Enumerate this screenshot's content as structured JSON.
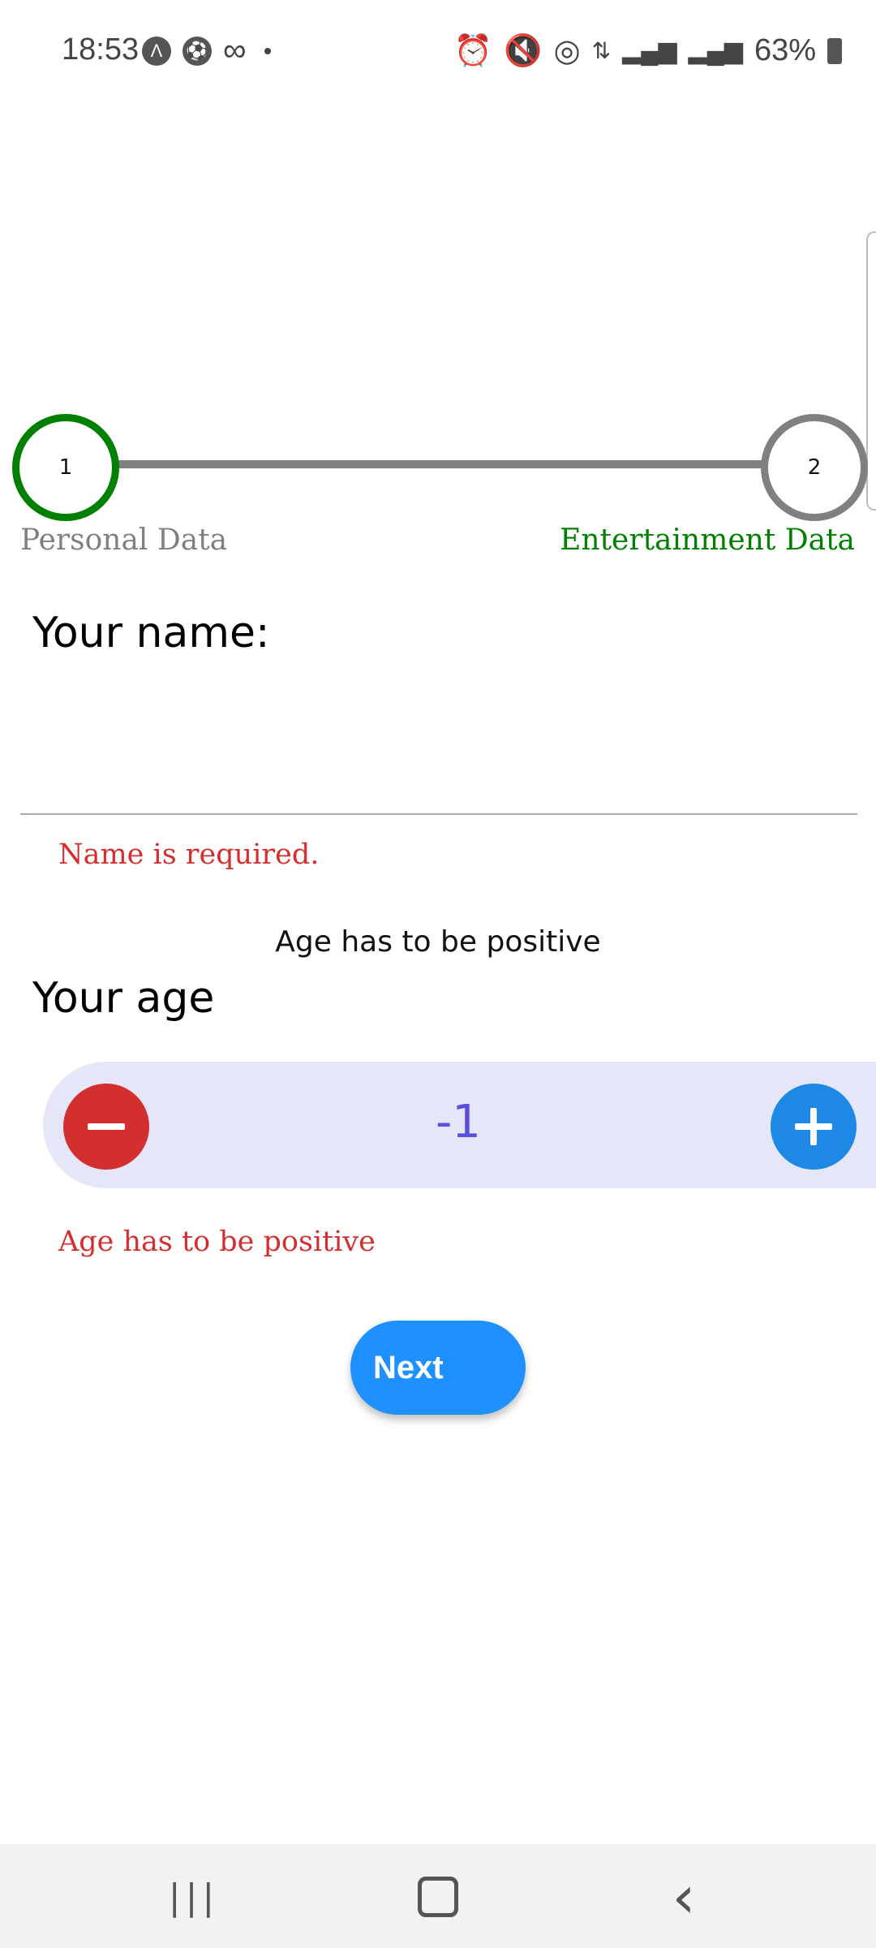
{
  "status_bar": {
    "time": "18:53",
    "icons_left": [
      "app-a-icon",
      "soccer-ball-icon",
      "infinity-icon",
      "notification-dot-icon"
    ],
    "icons_right": [
      "alarm-icon",
      "vibrate-mute-icon",
      "hotspot-icon",
      "data-arrows-icon",
      "signal-icon",
      "signal-icon"
    ],
    "battery": "63%"
  },
  "stepper": {
    "step1": {
      "number": "1",
      "label": "Personal Data",
      "color": "#008000"
    },
    "step2": {
      "number": "2",
      "label": "Entertainment Data",
      "color": "#808080"
    }
  },
  "form": {
    "name_label": "Your name:",
    "name_value": "",
    "name_error": "Name is required.",
    "age_hint": "Age has to be positive",
    "age_label": "Your age",
    "age_value": "-1",
    "age_error": "Age has to be positive",
    "next_label": "Next"
  },
  "nav": {
    "recents": "|||",
    "home": "▢",
    "back": "‹"
  },
  "colors": {
    "error": "#d32f2f",
    "primary": "#1e90ff",
    "stepper_bg": "#e5e6f8"
  }
}
